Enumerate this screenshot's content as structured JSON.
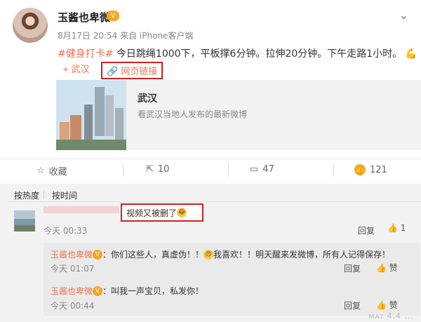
{
  "post": {
    "username": "玉酱也卑微",
    "vip_badge": "V",
    "meta": "8月17日 20:54 来自 iPhone客户端",
    "hashtag": "#健身打卡#",
    "text": " 今日跳绳1000下，平板撑6分钟。拉伸20分钟。下午走路1小时。",
    "location": "武汉",
    "link_label": "网页链接",
    "card_title": "武汉",
    "card_subtitle": "看武汉当地人发布的最新微博"
  },
  "actions": {
    "favorite": "收藏",
    "repost_count": "10",
    "comment_count": "47",
    "like_count": "121"
  },
  "comments": {
    "sort_hot": "按热度",
    "sort_time": "按时间",
    "items": [
      {
        "text": "视频又被删了",
        "time": "今天 00:33",
        "reply": "回复",
        "like_count": "1",
        "replies": [
          {
            "name": "玉酱也卑微",
            "text_before": "：你们这些人，真虚伪！！",
            "text_after": "我喜欢！！明天醒来发微博，所有人记得保存！",
            "time": "今天 01:07",
            "reply": "回复",
            "like": "赞"
          },
          {
            "name": "玉酱也卑微",
            "text_before": "：叫我一声宝贝，私发你！",
            "text_after": "",
            "time": "今天 00:44",
            "reply": "回复",
            "like": "赞"
          }
        ]
      }
    ]
  },
  "watermark": "ᴍᴀɪ 4.4 ...",
  "colors": {
    "accent": "#eb7350",
    "highlight_box": "#d02020"
  }
}
